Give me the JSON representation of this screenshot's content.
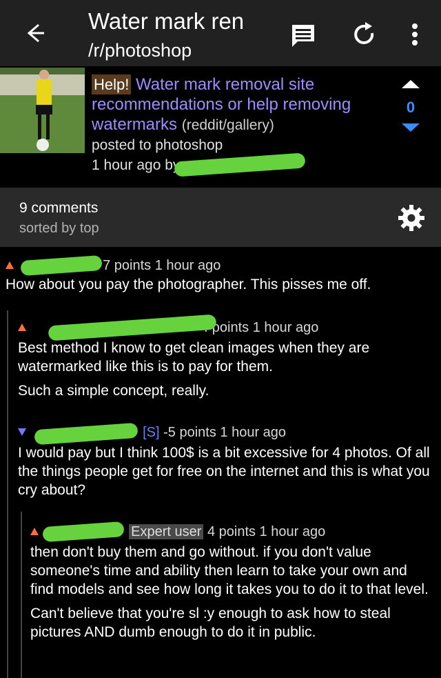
{
  "header": {
    "title": "Water mark ren",
    "subreddit": "/r/photoshop"
  },
  "post": {
    "flair": "Help!",
    "title": "Water mark removal site recommendations or help removing watermarks",
    "domain": "(reddit/gallery)",
    "posted_to": "posted to photoshop",
    "time": "1 hour ago by",
    "score": "0"
  },
  "comments_header": {
    "count": "9 comments",
    "sorted": "sorted by top"
  },
  "comments": [
    {
      "meta": "7 points 1 hour ago",
      "body": [
        "How about you pay the photographer. This pisses me off."
      ]
    },
    {
      "meta": "4 points 1 hour ago",
      "body": [
        "Best method I know to get clean images when they are watermarked like this is to pay for them.",
        "Such a simple concept, really."
      ]
    },
    {
      "meta_tag": "[S]",
      "meta": "-5 points 1 hour ago",
      "body": [
        "I would pay but I think 100$ is a bit excessive for 4 photos. Of all the things people get for free on the internet and this is what you cry about?"
      ]
    },
    {
      "flair": "Expert user",
      "meta": "4 points 1 hour ago",
      "body": [
        "then don't buy them and go without. if you don't value someone's time and ability then learn to take your own and find models and see how long it takes you to do it to that level.",
        "Can't believe that you're sl   :y enough to ask how to steal pictures AND dumb enough to do it in public."
      ]
    }
  ],
  "colors": {
    "accent_blue": "#3d8bfd",
    "upvote": "#ff6d3a",
    "downvote": "#6d7bff",
    "link": "#9c8cff",
    "redaction": "#66d23e"
  },
  "icons": [
    "back-arrow-icon",
    "comment-icon",
    "refresh-icon",
    "more-vert-icon",
    "upvote-icon",
    "downvote-icon",
    "gear-icon"
  ]
}
